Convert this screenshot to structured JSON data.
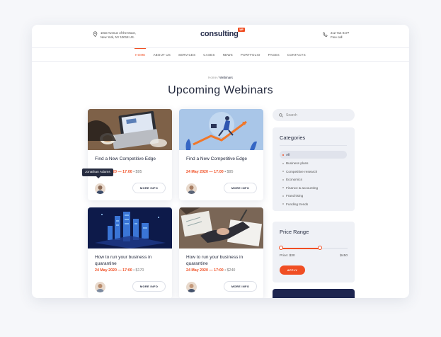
{
  "header": {
    "address_line1": "1010 Avenue of the Moon,",
    "address_line2": "New York, NY 10018 US.",
    "logo": "consulting",
    "logo_badge": "WP",
    "phone": "212 714 0177",
    "phone_sub": "Free call"
  },
  "nav": {
    "items": [
      "HOME",
      "ABOUT US",
      "SERVICES",
      "CASES",
      "NEWS",
      "PORTFOLIO",
      "PAGES",
      "CONTACTS"
    ],
    "active": "HOME"
  },
  "breadcrumb": {
    "home": "Home",
    "separator": "/",
    "current": "Webinars"
  },
  "page_title": "Upcoming Webinars",
  "cards": [
    {
      "title": "Find a New Competitive Edge",
      "date": "24 May 2020 — 17:00",
      "price": "$95",
      "button": "MORE INFO"
    },
    {
      "title": "Find a New Competitive Edge",
      "date": "24 May 2020 — 17:00",
      "price": "$95",
      "button": "MORE INFO"
    },
    {
      "title": "How to run your business in quarantine",
      "date": "24 May 2020 — 17:00",
      "price": "$170",
      "button": "MORE INFO"
    },
    {
      "title": "How to run your business in quarantine",
      "date": "24 May 2020 — 17:00",
      "price": "$240",
      "button": "MORE INFO"
    }
  ],
  "tooltip": "Jonathan Adams",
  "sidebar": {
    "search_placeholder": "Search",
    "categories_title": "Categories",
    "categories": [
      "All",
      "Business plans",
      "Competitive research",
      "Economics",
      "Finance & accounting",
      "Franchising",
      "Funding trends"
    ],
    "active_category": "All",
    "price_title": "Price Range",
    "price_label": "Price: $30",
    "price_max": "$450",
    "apply_label": "APPLY",
    "price_range": {
      "min": 30,
      "max": 450,
      "selected_max_fraction": 0.58
    }
  },
  "colors": {
    "accent": "#f04e23",
    "navy": "#1d2550",
    "text": "#262c40"
  },
  "separator": "•"
}
